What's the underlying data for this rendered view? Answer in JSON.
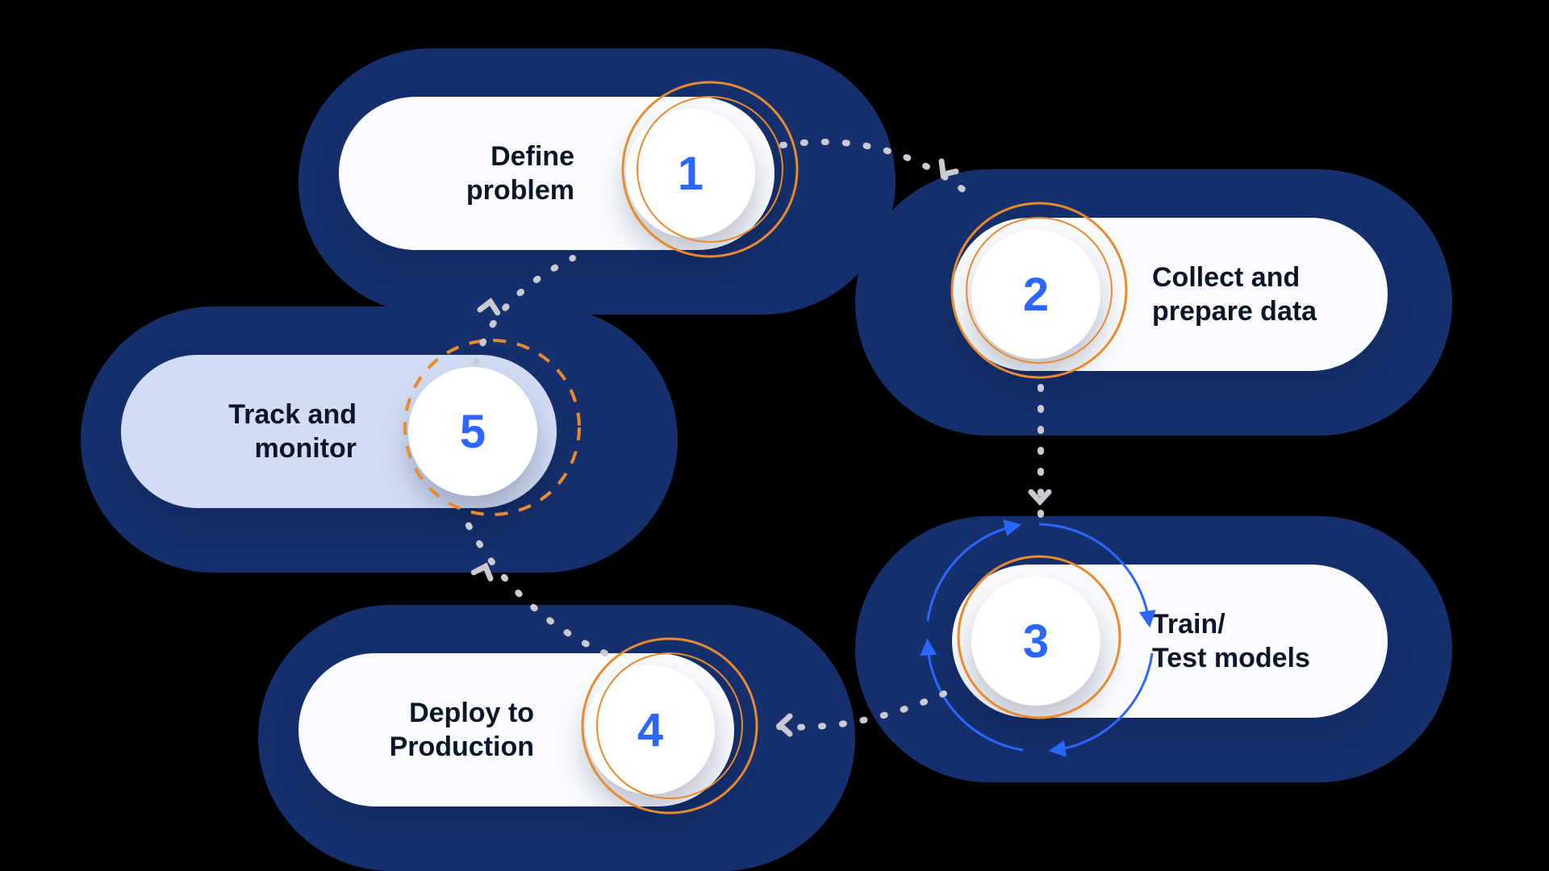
{
  "colors": {
    "navy": "#16306e",
    "accent_blue": "#2b66ff",
    "orange": "#e88a2d",
    "soft": "#d2ddf5",
    "white": "#f9fbff",
    "text": "#0c1628",
    "connector": "#c9cbd1"
  },
  "steps": [
    {
      "number": "1",
      "label": "Define\nproblem",
      "number_side": "right",
      "pill_style": "white",
      "ring": "solid"
    },
    {
      "number": "2",
      "label": "Collect and\nprepare data",
      "number_side": "left",
      "pill_style": "white",
      "ring": "solid"
    },
    {
      "number": "3",
      "label": "Train/\nTest models",
      "number_side": "left",
      "pill_style": "white",
      "ring": "solid",
      "iterate": true
    },
    {
      "number": "4",
      "label": "Deploy to\nProduction",
      "number_side": "right",
      "pill_style": "white",
      "ring": "solid"
    },
    {
      "number": "5",
      "label": "Track and\nmonitor",
      "number_side": "right",
      "pill_style": "soft",
      "ring": "dashed"
    }
  ],
  "flow": [
    "1",
    "2",
    "3",
    "4",
    "5",
    "1"
  ]
}
